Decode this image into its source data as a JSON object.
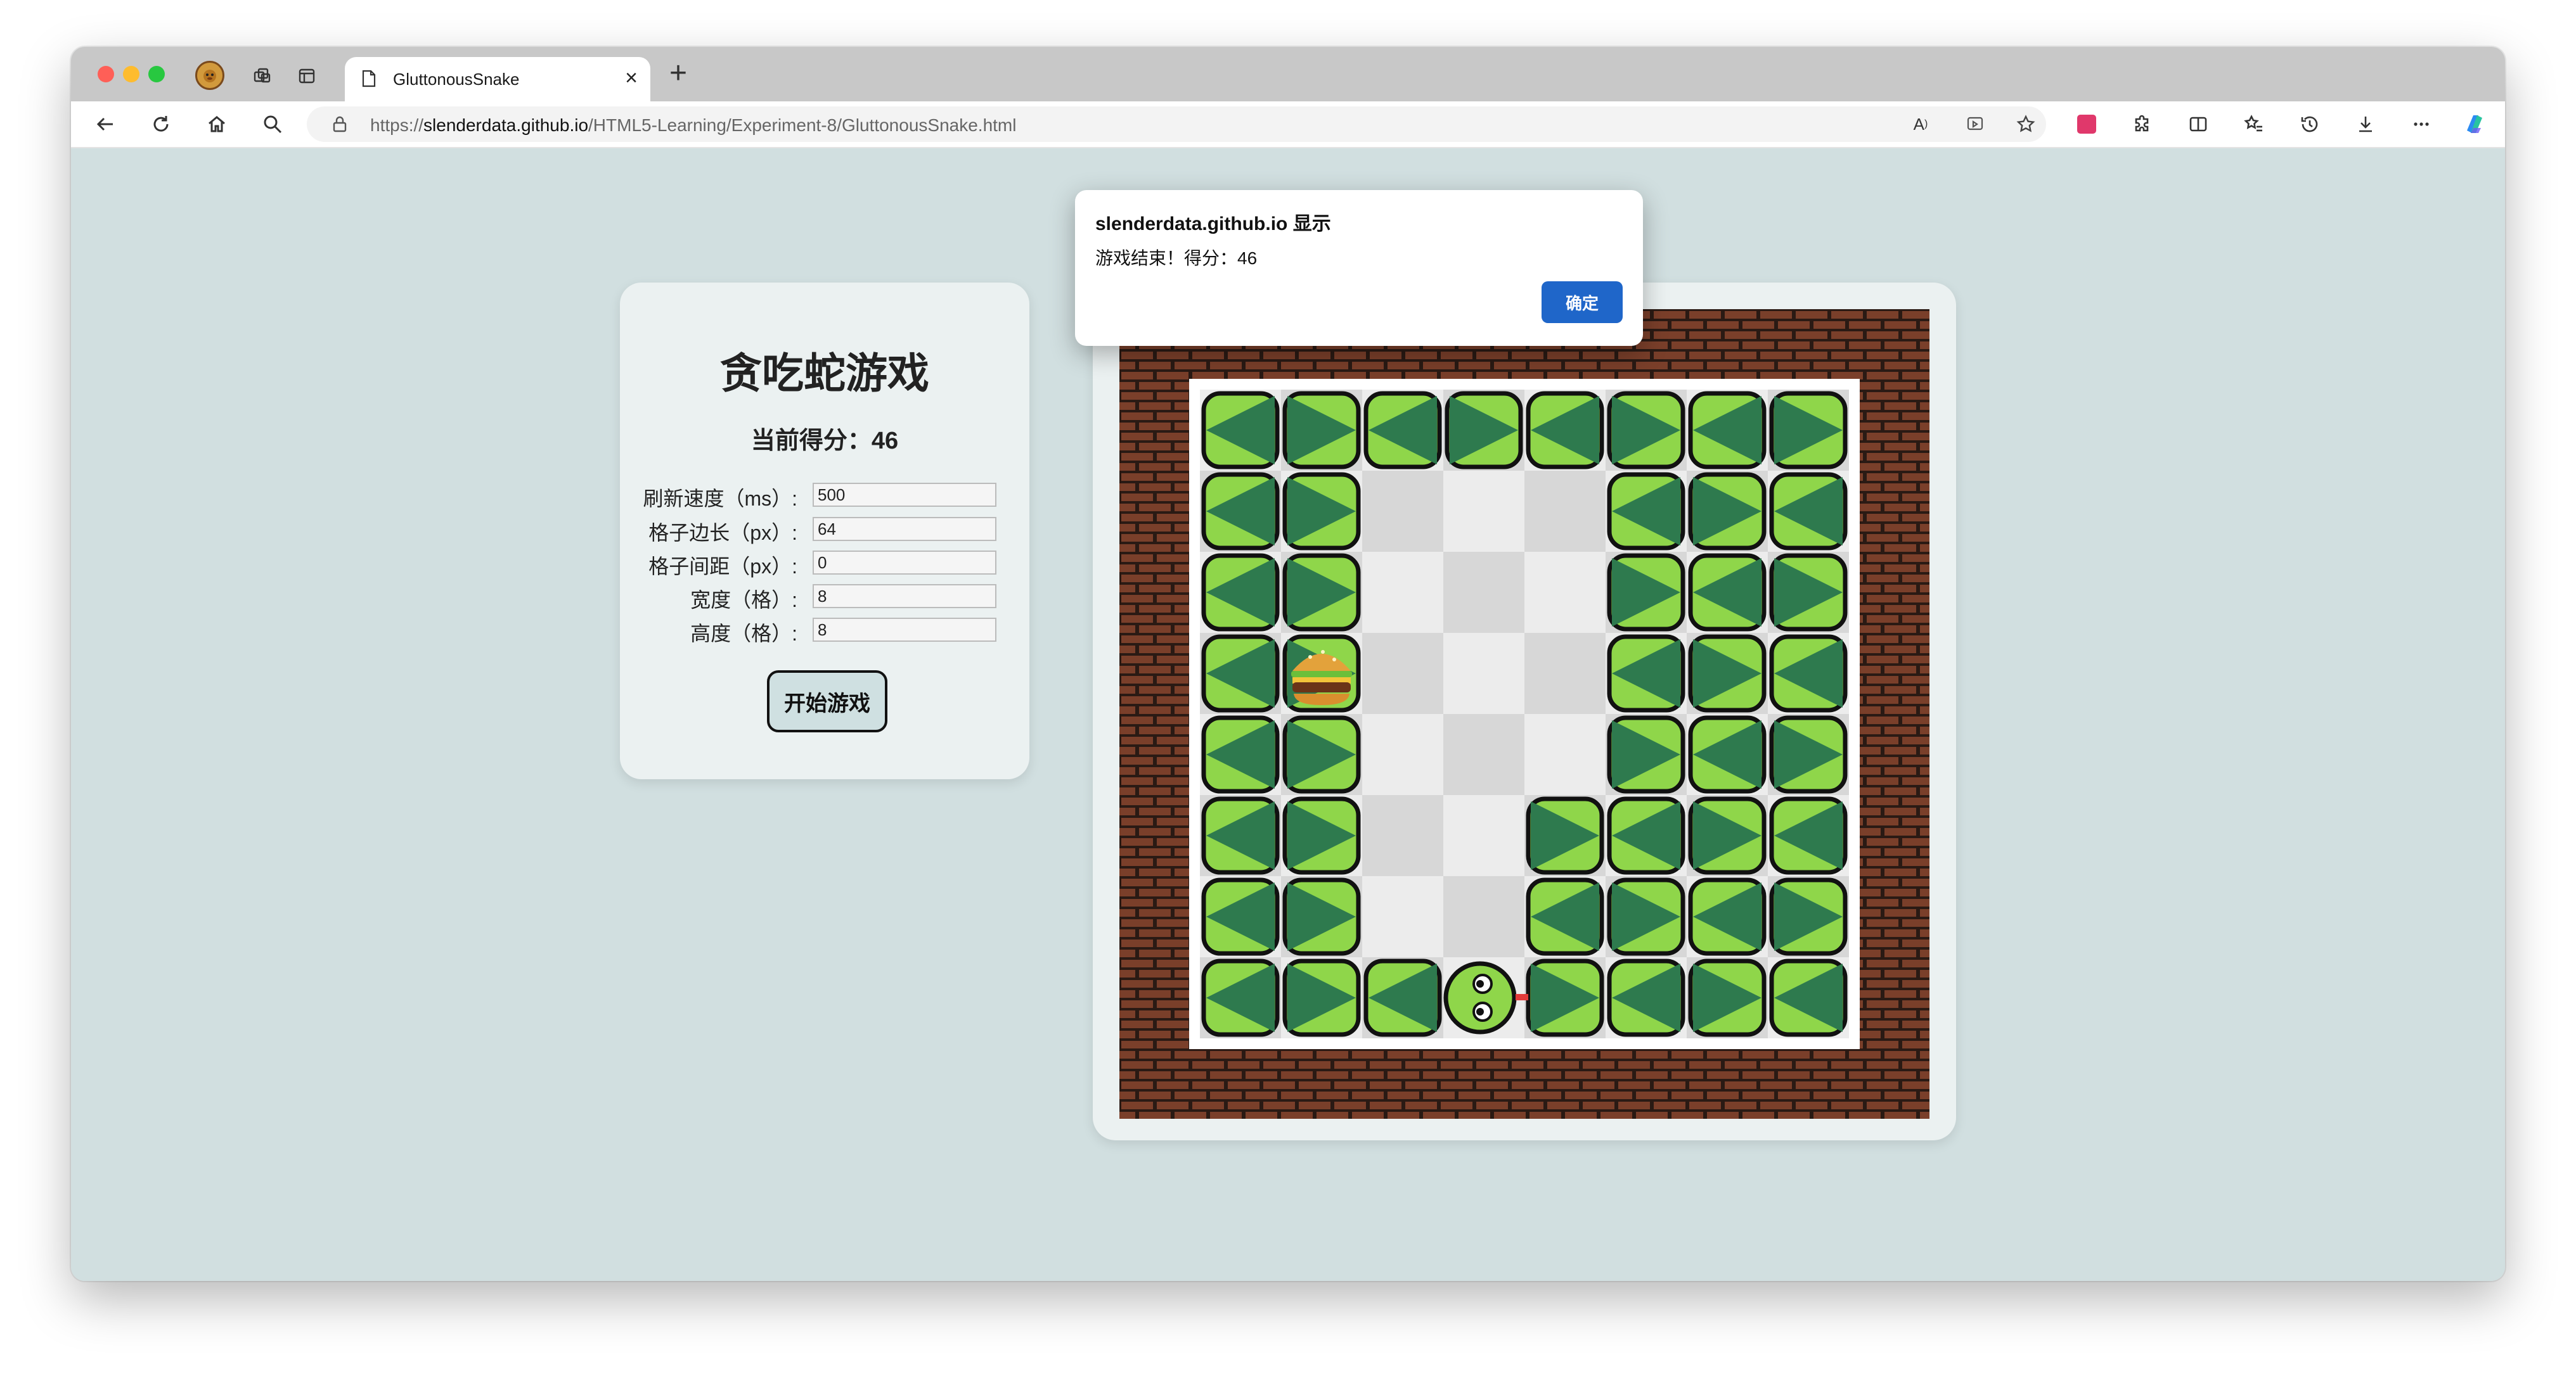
{
  "browser": {
    "tab_title": "GluttonousSnake",
    "url_prefix": "https://",
    "url_host": "slenderdata.github.io",
    "url_path": "/HTML5-Learning/Experiment-8/GluttonousSnake.html",
    "tab_close": "×",
    "new_tab": "+",
    "accent_color": "#1f66c9"
  },
  "panel": {
    "title": "贪吃蛇游戏",
    "score_label": "当前得分：",
    "score_value": "46",
    "fields": [
      {
        "label": "刷新速度（ms）:",
        "value": "500"
      },
      {
        "label": "格子边长（px）:",
        "value": "64"
      },
      {
        "label": "格子间距（px）:",
        "value": "0"
      },
      {
        "label": "宽度（格）:",
        "value": "8"
      },
      {
        "label": "高度（格）:",
        "value": "8"
      }
    ],
    "start_button": "开始游戏"
  },
  "dialog": {
    "title": "slenderdata.github.io 显示",
    "message": "游戏结束！得分：46",
    "ok_label": "确定"
  },
  "game": {
    "grid_cols": 8,
    "grid_rows": 8,
    "food_icon": "hamburger-icon",
    "food_cell": [
      1,
      3
    ],
    "snake_head_cell": [
      3,
      7
    ],
    "colors": {
      "brick": "#7a3f2a",
      "mortar": "#2a1a14",
      "snake_light": "#8fd64a",
      "snake_dark": "#2e7a4e",
      "tile_light": "#ececec",
      "tile_dark": "#d7d7d7"
    }
  }
}
